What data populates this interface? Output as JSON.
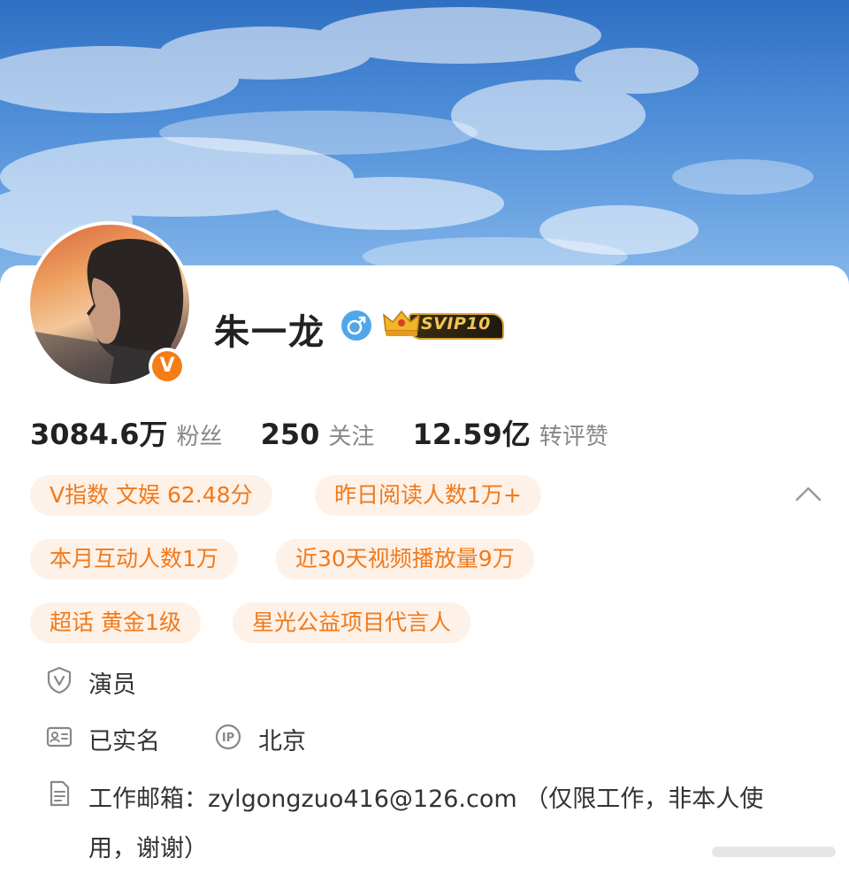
{
  "profile": {
    "name": "朱一龙",
    "verified_badge": "V",
    "gender_icon": "male-icon",
    "vip_label": "SVIP10"
  },
  "stats": [
    {
      "value": "3084.6万",
      "label": "粉丝"
    },
    {
      "value": "250",
      "label": "关注"
    },
    {
      "value": "12.59亿",
      "label": "转评赞"
    }
  ],
  "tags": [
    {
      "text": "V指数 文娱 62.48分"
    },
    {
      "text": "昨日阅读人数1万+"
    },
    {
      "text": "本月互动人数1万"
    },
    {
      "text": "近30天视频播放量9万"
    },
    {
      "text": "超话 黄金1级"
    },
    {
      "text": "星光公益项目代言人"
    }
  ],
  "info": {
    "occupation": "演员",
    "real_name": "已实名",
    "ip_location": "北京",
    "email_line": "工作邮箱：zylgongzuo416@126.com （仅限工作，非本人使用，谢谢）"
  },
  "colors": {
    "accent": "#f07a1c",
    "tag_bg": "#fdf1e8",
    "gender_blue": "#4fa7ea",
    "vip_gold": "#f2c552"
  },
  "icons": [
    "chevron-up-icon",
    "shield-v-icon",
    "id-card-icon",
    "ip-icon",
    "document-icon"
  ]
}
